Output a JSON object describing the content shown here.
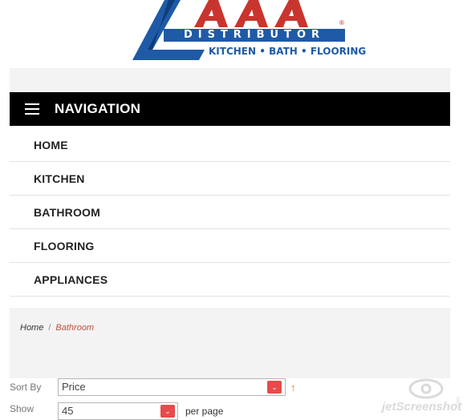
{
  "logo": {
    "brand": "AAA",
    "subtitle": "DISTRIBUTOR",
    "tagline": "KITCHEN • BATH • FLOORING",
    "registered": "®",
    "colors": {
      "blue": "#1f5aa6",
      "red": "#c8352f"
    }
  },
  "nav": {
    "title": "NAVIGATION",
    "items": [
      {
        "label": "HOME"
      },
      {
        "label": "KITCHEN"
      },
      {
        "label": "BATHROOM"
      },
      {
        "label": "FLOORING"
      },
      {
        "label": "APPLIANCES"
      }
    ]
  },
  "breadcrumb": {
    "home": "Home",
    "separator": "/",
    "current": "Bathroom"
  },
  "toolbar": {
    "sort_label": "Sort By",
    "sort_value": "Price",
    "sort_direction_icon": "↑",
    "show_label": "Show",
    "show_value": "45",
    "per_page_label": "per page",
    "dropdown_icon": "⌄"
  },
  "watermark": {
    "text": "jetScreenshot",
    "suffix": ".com"
  }
}
